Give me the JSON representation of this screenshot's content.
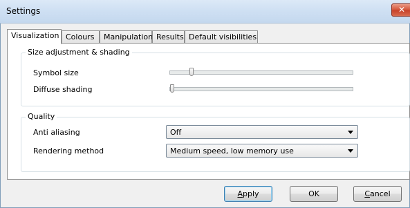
{
  "window": {
    "title": "Settings",
    "close_label": "✕"
  },
  "tabs": [
    {
      "label": "Visualization",
      "active": true
    },
    {
      "label": "Colours"
    },
    {
      "label": "Manipulation"
    },
    {
      "label": "Results"
    },
    {
      "label": "Default visibilities"
    }
  ],
  "size_group": {
    "title": "Size adjustment & shading",
    "symbol_size": {
      "label": "Symbol size",
      "level": 0.11
    },
    "diffuse_shading": {
      "label": "Diffuse shading",
      "level": 0.0
    }
  },
  "quality_group": {
    "title": "Quality",
    "anti_aliasing": {
      "label": "Anti aliasing",
      "value": "Off"
    },
    "rendering_method": {
      "label": "Rendering method",
      "value": "Medium speed, low memory use"
    }
  },
  "buttons": {
    "apply": {
      "underline": "A",
      "rest": "pply"
    },
    "ok": "OK",
    "cancel": {
      "underline": "C",
      "rest": "ancel"
    }
  }
}
